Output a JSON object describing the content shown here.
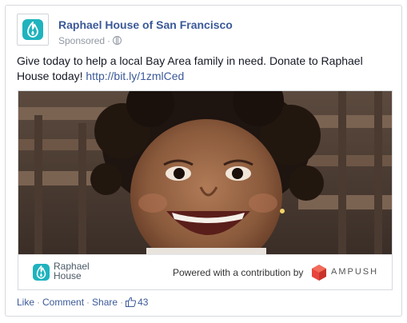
{
  "post": {
    "page_name": "Raphael House of San Francisco",
    "sponsored_label": "Sponsored",
    "meta_dot": "·",
    "message": "Give today to help a local Bay Area family in need. Donate to Raphael House today!",
    "link_text": "http://bit.ly/1zmlCed"
  },
  "attachment": {
    "brand_line1": "Raphael",
    "brand_line2": "House",
    "powered_text": "Powered with a contribution by",
    "sponsor_name": "AMPUSH"
  },
  "actions": {
    "like": "Like",
    "comment": "Comment",
    "share": "Share",
    "sep": "·",
    "like_count": "43"
  },
  "colors": {
    "link_blue": "#3b5998",
    "brand_teal": "#1fb3be",
    "ampush_red": "#e8453c"
  },
  "icons": [
    "raphael-house-logo-icon",
    "globe-icon",
    "ampush-logo-icon",
    "thumbs-up-icon"
  ]
}
